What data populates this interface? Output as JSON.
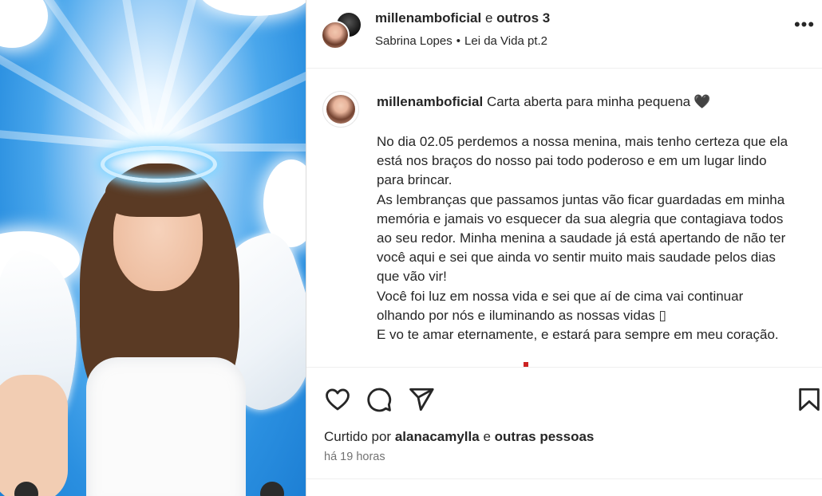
{
  "header": {
    "username": "millenamboficial",
    "joiner": "e",
    "others": "outros 3",
    "audio_artist": "Sabrina Lopes",
    "audio_separator": "•",
    "audio_title": "Lei da Vida pt.2",
    "more_icon": "more-horizontal-icon",
    "more_glyph": "•••"
  },
  "caption": {
    "username": "millenamboficial",
    "title": "Carta aberta para minha pequena",
    "title_emoji": "🖤",
    "body": "No dia 02.05 perdemos a nossa menina, mais tenho certeza que ela\nestá nos braços do nosso pai todo poderoso e em um lugar lindo\npara brincar.\nAs lembranças que passamos juntas vão ficar guardadas em minha\nmemória e jamais vo esquecer da sua alegria que contagiava todos\nao seu redor. Minha menina a saudade já está apertando de não ter\nvocê aqui e sei que ainda vo sentir muito mais saudade pelos dias\nque vão vir!\nVocê foi luz em nossa vida e sei que aí de cima vai continuar\nolhando por nós e iluminando as nossas vidas ▯\nE vo te amar eternamente, e estará para sempre em meu coração."
  },
  "actions": {
    "like_icon": "heart-icon",
    "comment_icon": "comment-icon",
    "share_icon": "send-icon",
    "save_icon": "bookmark-icon"
  },
  "likes": {
    "prefix": "Curtido por",
    "user": "alanacamylla",
    "joiner": "e",
    "others": "outras pessoas"
  },
  "time": "há 19 horas",
  "colors": {
    "text": "#262626",
    "muted": "#737373",
    "divider": "#efefef",
    "sky": "#2a8fe0"
  }
}
